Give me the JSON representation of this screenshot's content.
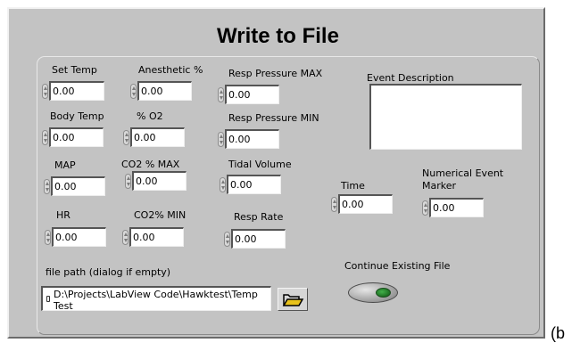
{
  "panel": {
    "title": "Write to File"
  },
  "fields": {
    "set_temp": {
      "label": "Set Temp",
      "value": "0.00"
    },
    "anesthetic": {
      "label": "Anesthetic %",
      "value": "0.00"
    },
    "resp_pressure_max": {
      "label": "Resp Pressure MAX",
      "value": "0.00"
    },
    "body_temp": {
      "label": "Body Temp",
      "value": "0.00"
    },
    "o2": {
      "label": "% O2",
      "value": "0.00"
    },
    "resp_pressure_min": {
      "label": "Resp Pressure MIN",
      "value": "0.00"
    },
    "map": {
      "label": "MAP",
      "value": "0.00"
    },
    "co2_max": {
      "label": "CO2 % MAX",
      "value": "0.00"
    },
    "tidal_volume": {
      "label": "Tidal Volume",
      "value": "0.00"
    },
    "hr": {
      "label": "HR",
      "value": "0.00"
    },
    "co2_min": {
      "label": "CO2% MIN",
      "value": "0.00"
    },
    "resp_rate": {
      "label": "Resp Rate",
      "value": "0.00"
    },
    "time": {
      "label": "Time",
      "value": "0.00"
    },
    "event_marker": {
      "label_line1": "Numerical Event",
      "label_line2": "Marker",
      "value": "0.00"
    }
  },
  "event_description": {
    "label": "Event Description",
    "value": ""
  },
  "file_path": {
    "label": "file path (dialog if empty)",
    "line1": "D:\\Projects\\LabView Code\\Hawktest\\Temp",
    "line2": "Test"
  },
  "continue_toggle": {
    "label": "Continue Existing File",
    "state": "on",
    "lamp_color": "#2e8b37"
  },
  "browse_button": {
    "icon": "open-folder-icon"
  },
  "outside_text": "(b"
}
